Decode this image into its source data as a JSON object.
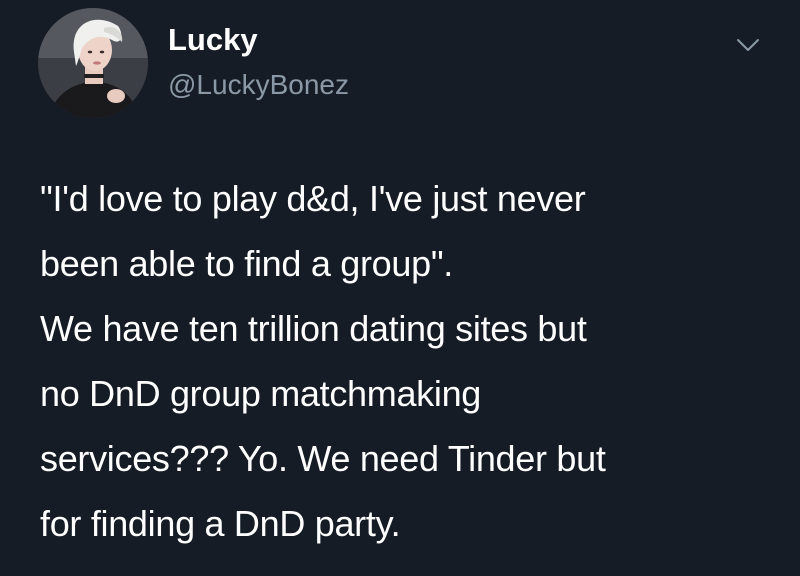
{
  "tweet": {
    "author": {
      "display_name": "Lucky",
      "handle": "@LuckyBonez",
      "avatar_icon": "profile-avatar"
    },
    "menu_icon": "chevron-down-icon",
    "lines": [
      "\"I'd love to play d&d, I've just never",
      "been able to find a group\".",
      "We have ten trillion dating sites but",
      "no DnD group matchmaking",
      "services??? Yo. We need Tinder but",
      "for finding a DnD party."
    ]
  },
  "colors": {
    "background": "#151c26",
    "text": "#ffffff",
    "secondary_text": "#8b98a5"
  }
}
